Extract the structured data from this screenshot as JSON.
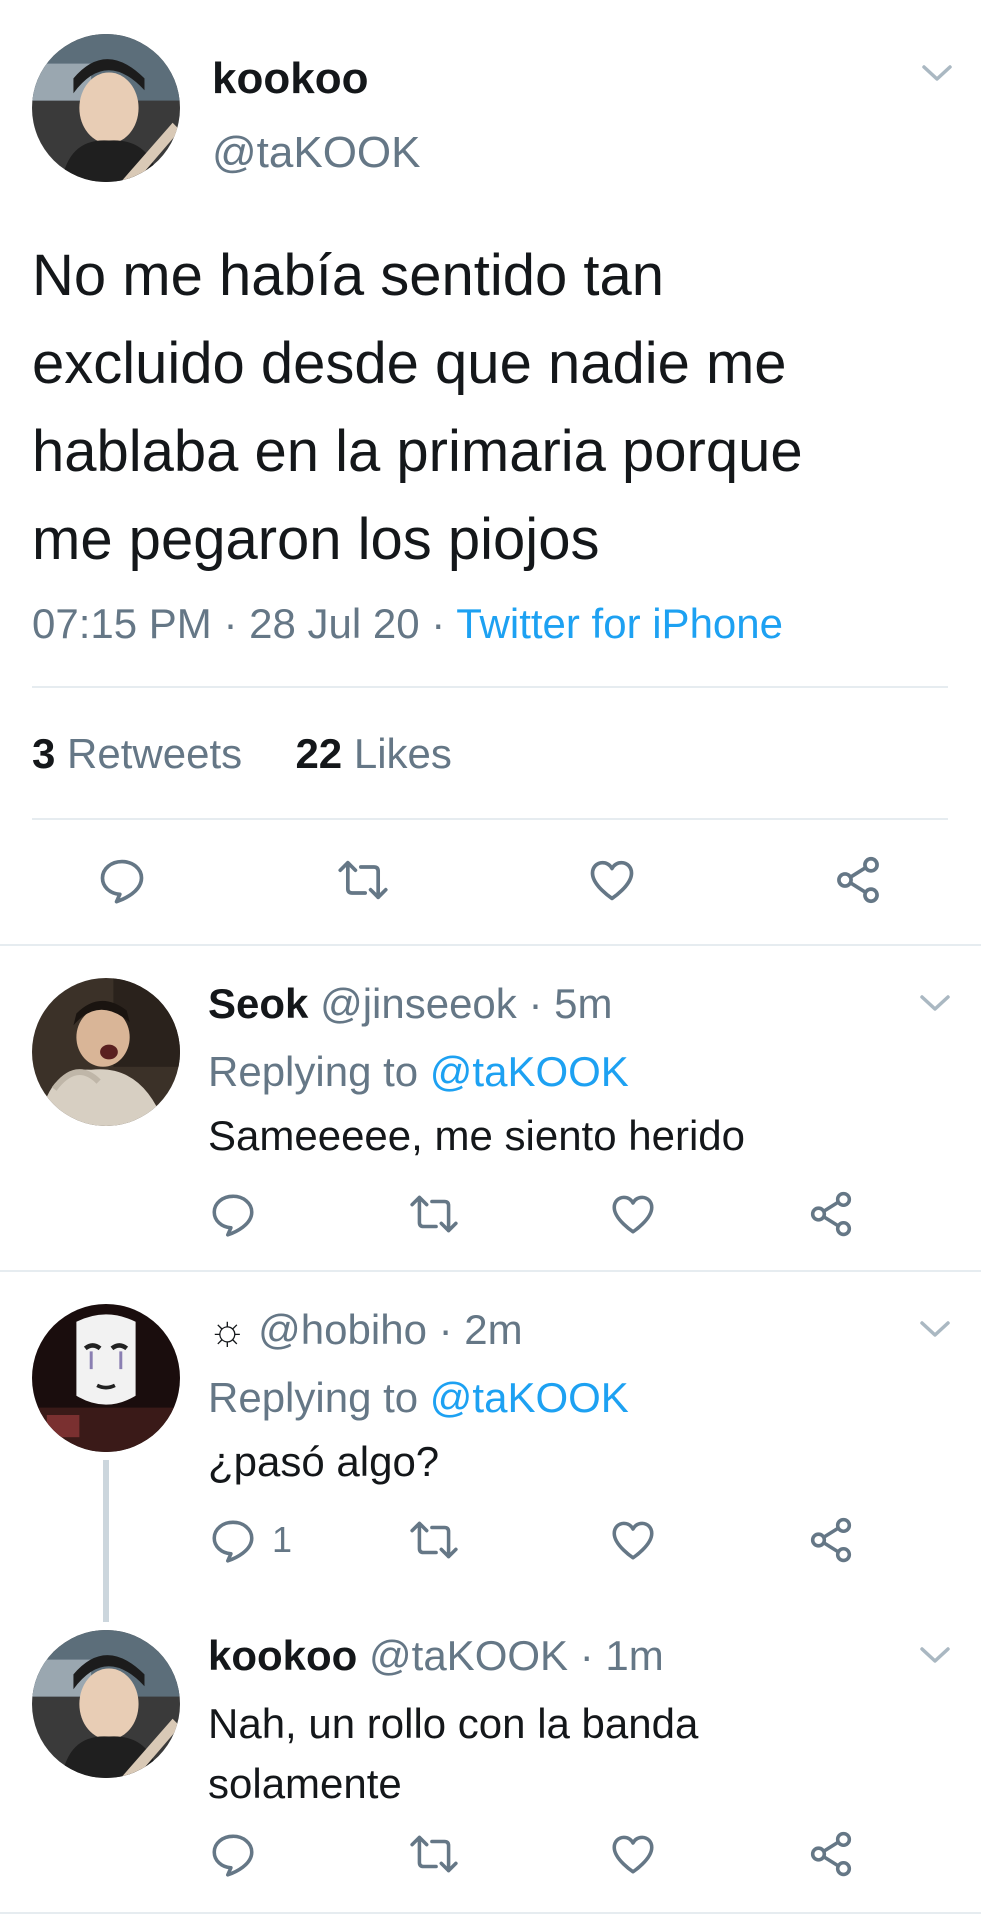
{
  "main_tweet": {
    "display_name": "kookoo",
    "handle": "@taKOOK",
    "text_lines": [
      "No me había sentido tan",
      "excluido desde que nadie me",
      "hablaba en la primaria porque",
      "me pegaron los piojos"
    ],
    "time": "07:15 PM",
    "date": "28 Jul 20",
    "separator": "·",
    "source": "Twitter for iPhone",
    "retweets_count": "3",
    "retweets_label": "Retweets",
    "likes_count": "22",
    "likes_label": "Likes"
  },
  "replies": [
    {
      "display_name": "Seok",
      "handle": "@jinseeok",
      "sep": "·",
      "time": "5m",
      "replying_to_label": "Replying to",
      "replying_to_handle": "@taKOOK",
      "text": "Sameeeee, me siento herido"
    },
    {
      "display_name": "☼",
      "handle": "@hobiho",
      "sep": "·",
      "time": "2m",
      "replying_to_label": "Replying to",
      "replying_to_handle": "@taKOOK",
      "text": "¿pasó algo?",
      "reply_count": "1"
    },
    {
      "display_name": "kookoo",
      "handle": "@taKOOK",
      "sep": "·",
      "time": "1m",
      "text_lines": [
        "Nah, un rollo con la banda",
        "solamente"
      ]
    }
  ],
  "icons": {
    "reply": "reply-icon",
    "retweet": "retweet-icon",
    "like": "like-icon",
    "share": "share-icon",
    "menu": "chevron-down-icon"
  },
  "colors": {
    "link_blue": "#1da1f2",
    "secondary_grey": "#657786",
    "divider": "#e6ecf0",
    "thread_line": "#ccd6dd"
  }
}
